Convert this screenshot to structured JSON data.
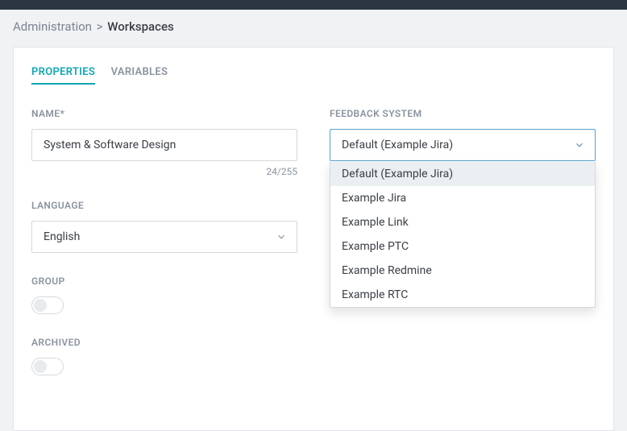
{
  "breadcrumb": {
    "parent": "Administration",
    "current": "Workspaces"
  },
  "tabs": {
    "properties": "PROPERTIES",
    "variables": "VARIABLES"
  },
  "fields": {
    "name": {
      "label": "NAME*",
      "value": "System & Software Design",
      "count": "24/255"
    },
    "language": {
      "label": "LANGUAGE",
      "value": "English"
    },
    "feedback": {
      "label": "FEEDBACK SYSTEM",
      "value": "Default (Example Jira)",
      "options": [
        "Default (Example Jira)",
        "Example Jira",
        "Example Link",
        "Example PTC",
        "Example Redmine",
        "Example RTC"
      ]
    },
    "group": {
      "label": "GROUP"
    },
    "archived": {
      "label": "ARCHIVED"
    }
  }
}
